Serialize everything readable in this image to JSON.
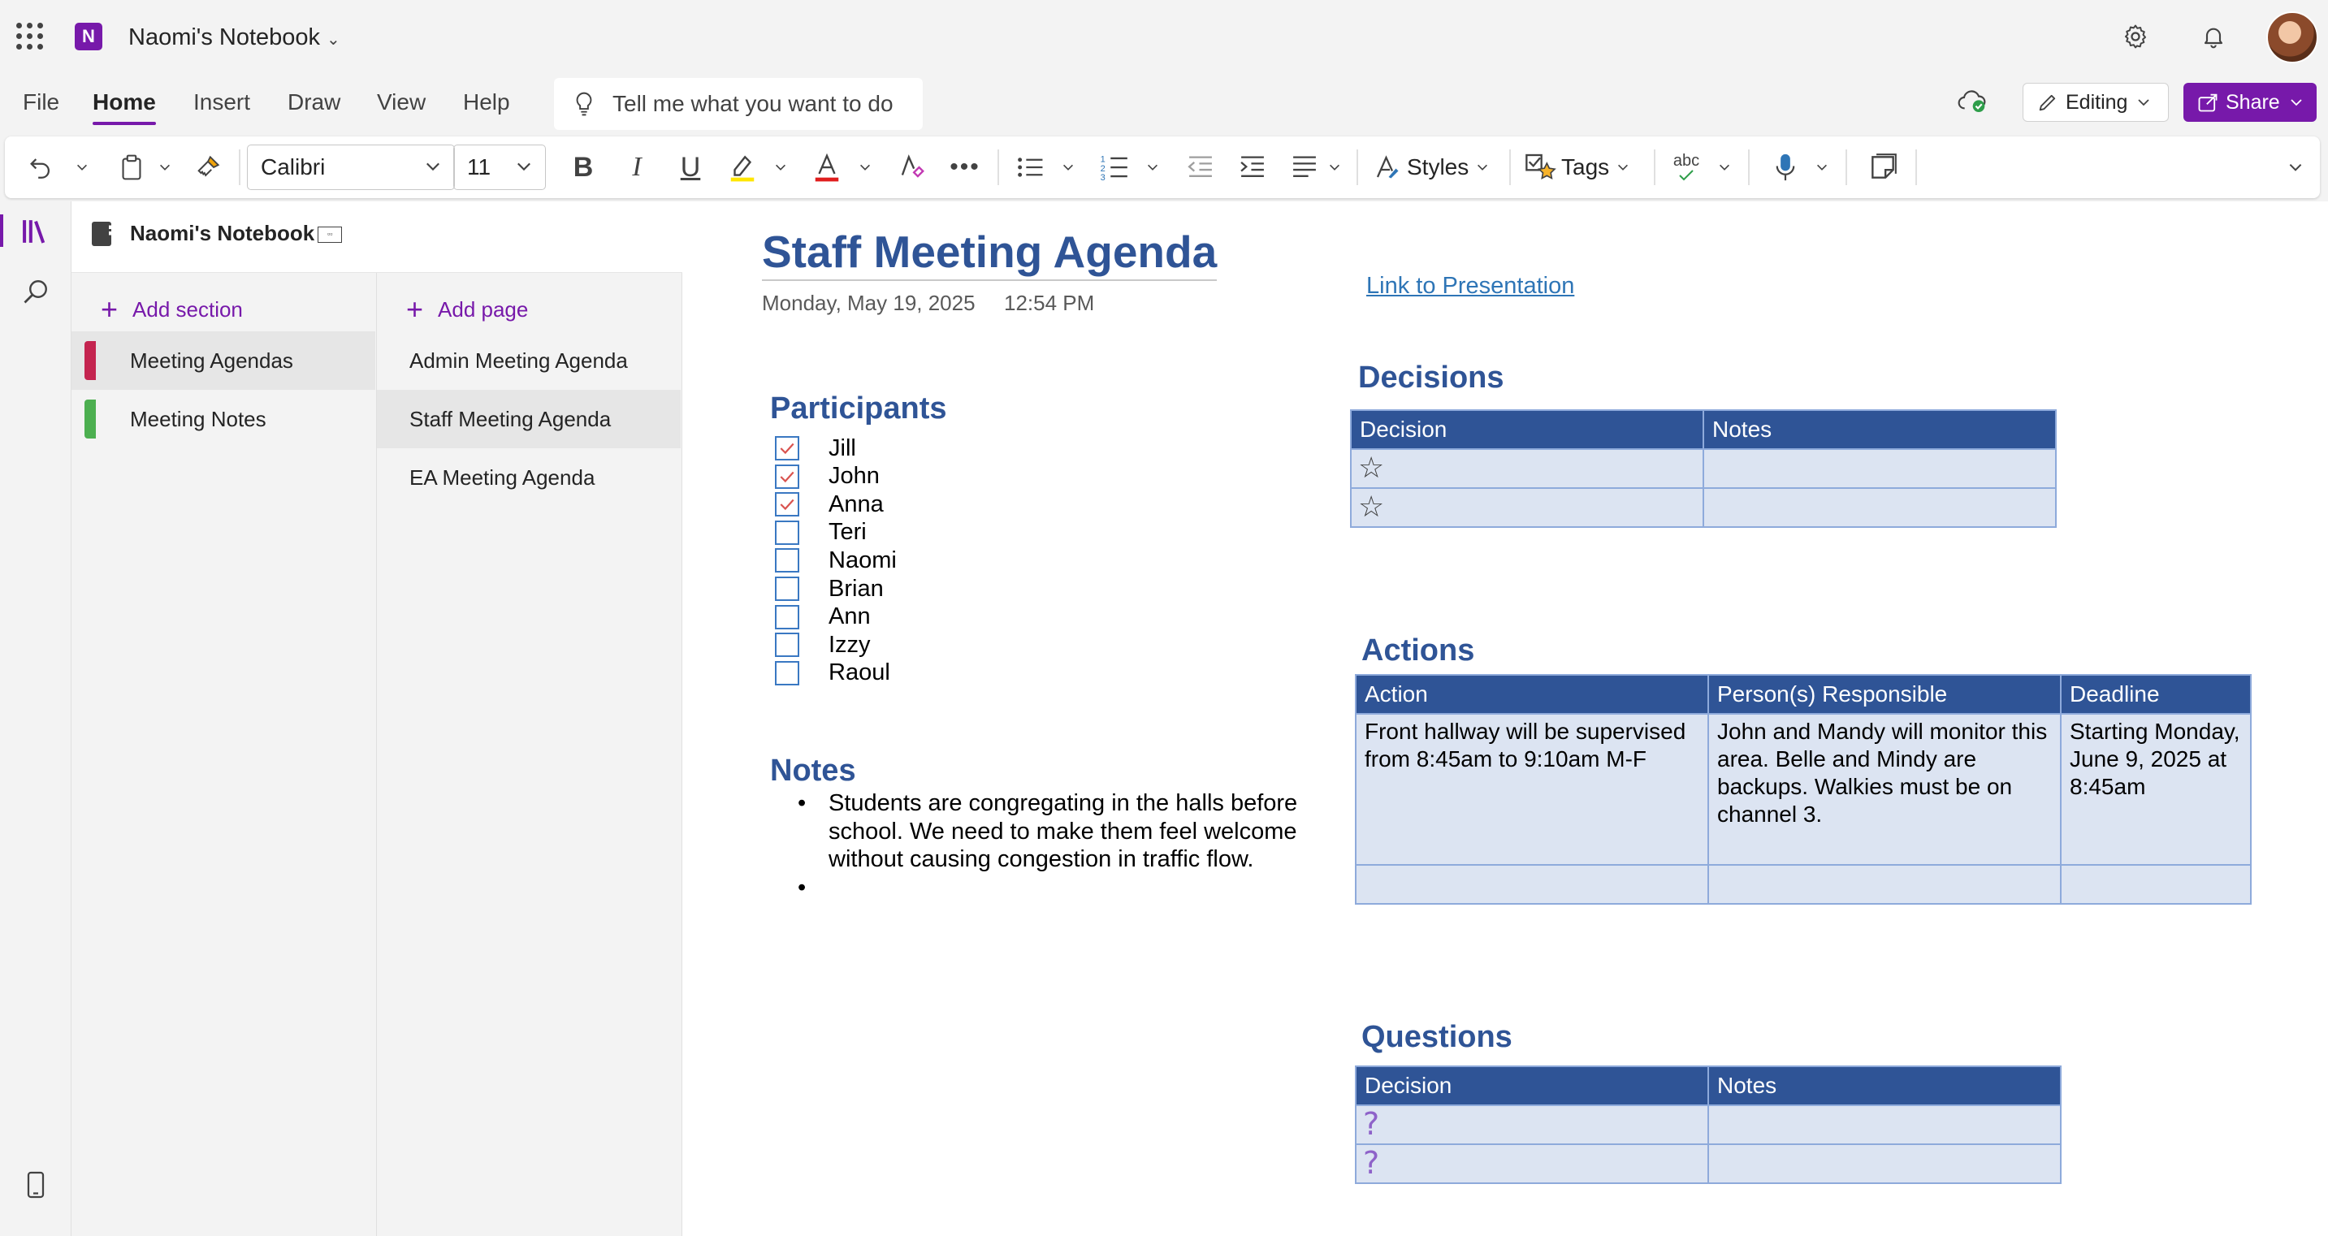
{
  "app": {
    "notebook_title": "Naomi's Notebook",
    "brand_color": "#7719aa"
  },
  "menu": {
    "tabs": [
      "File",
      "Home",
      "Insert",
      "Draw",
      "View",
      "Help"
    ],
    "active_tab": "Home",
    "tell_me_placeholder": "Tell me what you want to do",
    "editing_label": "Editing",
    "share_label": "Share"
  },
  "ribbon": {
    "font_name": "Calibri",
    "font_size": "11",
    "styles_label": "Styles",
    "tags_label": "Tags",
    "spelling_label": "abc",
    "highlight_color": "#ffe600",
    "font_color": "#e01e1e"
  },
  "nav": {
    "notebook_name": "Naomi's Notebook",
    "add_section_label": "Add section",
    "add_page_label": "Add page",
    "sections": [
      {
        "label": "Meeting Agendas",
        "color": "#c4244f"
      },
      {
        "label": "Meeting Notes",
        "color": "#4caf50"
      }
    ],
    "selected_section": "Meeting Agendas",
    "pages": [
      "Admin Meeting Agenda",
      "Staff Meeting Agenda",
      "EA Meeting Agenda"
    ],
    "selected_page": "Staff Meeting Agenda"
  },
  "page": {
    "title": "Staff Meeting Agenda",
    "date": "Monday, May 19, 2025",
    "time": "12:54 PM",
    "link_text": "Link to Presentation",
    "participants_heading": "Participants",
    "participants": [
      {
        "name": "Jill",
        "checked": true
      },
      {
        "name": "John",
        "checked": true
      },
      {
        "name": "Anna",
        "checked": true
      },
      {
        "name": "Teri",
        "checked": false
      },
      {
        "name": "Naomi",
        "checked": false
      },
      {
        "name": "Brian",
        "checked": false
      },
      {
        "name": "Ann",
        "checked": false
      },
      {
        "name": "Izzy",
        "checked": false
      },
      {
        "name": "Raoul",
        "checked": false
      }
    ],
    "notes_heading": "Notes",
    "notes": [
      "Students are congregating in the halls before school. We need to make them feel welcome without causing congestion in traffic flow.",
      ""
    ],
    "decisions_heading": "Decisions",
    "decisions_table": {
      "headers": [
        "Decision",
        "Notes"
      ],
      "rows": [
        [
          "",
          ""
        ],
        [
          "",
          ""
        ]
      ],
      "row_icon": "star-icon"
    },
    "actions_heading": "Actions",
    "actions_table": {
      "headers": [
        "Action",
        "Person(s) Responsible",
        "Deadline"
      ],
      "rows": [
        [
          "Front hallway will be supervised from 8:45am to 9:10am M-F",
          "John and Mandy will monitor this area. Belle and Mindy are backups. Walkies must be on channel 3.",
          "Starting Monday, June 9, 2025 at 8:45am"
        ],
        [
          "",
          "",
          ""
        ]
      ]
    },
    "questions_heading": "Questions",
    "questions_table": {
      "headers": [
        "Decision",
        "Notes"
      ],
      "rows": [
        [
          "",
          ""
        ],
        [
          "",
          ""
        ]
      ],
      "row_icon": "question-icon"
    },
    "heading_color": "#2f5496",
    "table_header_color": "#2f5496",
    "table_cell_color": "#dce4f2"
  }
}
